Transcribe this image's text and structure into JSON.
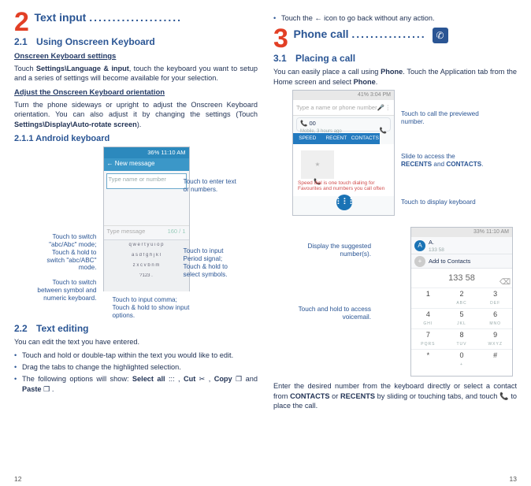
{
  "left": {
    "sec_num": "2",
    "sec_title": "Text input",
    "sec_dots": "....................",
    "s21_num": "2.1",
    "s21_title": "Using Onscreen Keyboard",
    "sub_a": "Onscreen Keyboard settings",
    "para_a": "Touch <b>Settings\\Language & input</b>, touch the keyboard you want to setup and a series of settings will become available for your selection.",
    "sub_b": "Adjust the Onscreen Keyboard orientation",
    "para_b": "Turn the phone sideways or upright to adjust the Onscreen Keyboard orientation. You can also adjust it by changing the settings (Touch <b>Settings\\Display\\Auto-rotate screen</b>).",
    "s211_num": "2.1.1",
    "s211_title": "Android keyboard",
    "shot1": {
      "status": "36%  11:10 AM",
      "title": "New message",
      "field": "Type name or number",
      "counter": "160 / 1",
      "msg": "Type message",
      "row1": "q w e r t y u i o p",
      "row2": "a s d f g h j k l",
      "row3": "z x c v b n m",
      "row4": "?123        ."
    },
    "callouts1": {
      "c1": "Touch to enter text or numbers.",
      "c2": "Touch to switch \"abc/Abc\" mode; Touch & hold to switch \"abc/ABC\" mode.",
      "c3": "Touch to switch between symbol and numeric keyboard.",
      "c4": "Touch to input Period signal;\nTouch & hold to select symbols.",
      "c5": "Touch to input comma;\nTouch & hold to show input options."
    },
    "s22_num": "2.2",
    "s22_title": "Text editing",
    "para_c": "You can edit the text you have entered.",
    "bullets": [
      "Touch and hold or double-tap within the text you would like to edit.",
      "Drag the tabs to change the highlighted selection.",
      "The following options will show: <b>Select all</b> :::  , <b>Cut</b> ✂ , <b>Copy</b> ❐ and <b>Paste</b> ❐ ."
    ],
    "pagenum": "12"
  },
  "right": {
    "top_bullet": "Touch the ← icon to go back without any action.",
    "sec_num": "3",
    "sec_title": "Phone call",
    "sec_dots": "................",
    "s31_num": "3.1",
    "s31_title": "Placing a call",
    "para_a": "You can easily place a call using <b>Phone</b>. Touch the Application tab from the Home screen and select <b>Phone</b>.",
    "shot2": {
      "status": "41%  3:04 PM",
      "search": "Type a name or phone number",
      "pill_top": "00",
      "pill_sub": "Mobile, 3 hours ago",
      "tab1": "SPEED DIAL",
      "tab2": "RECENT",
      "tab3": "CONTACTS",
      "bodytxt": "Speed dial is one touch dialing for Favourites and numbers you call often"
    },
    "callouts2": {
      "c1": "Touch to call the previewed number.",
      "c2": "Slide to access the <b>RECENTS</b> and <b>CONTACTS</b>.",
      "c3": "Touch to display keyboard"
    },
    "shot3": {
      "status": "33%  11:10 AM",
      "sel_top": "A.",
      "sel_sub": "133 58",
      "add": "Add to Contacts",
      "number": "133 58",
      "keys": [
        "1",
        "2",
        "3",
        "4",
        "5",
        "6",
        "7",
        "8",
        "9",
        "*",
        "0",
        "#"
      ],
      "sub": [
        "",
        "ABC",
        "DEF",
        "GHI",
        "JKL",
        "MNO",
        "PQRS",
        "TUV",
        "WXYZ",
        "",
        "+",
        ""
      ]
    },
    "callouts3": {
      "c1": "Display the suggested number(s).",
      "c2": "Touch and hold to access voicemail."
    },
    "para_b": "Enter the desired number from the keyboard directly or select a contact from <b>CONTACTS</b> or <b>RECENTS</b> by sliding or touching tabs, and touch 📞 to place the call.",
    "pagenum": "13"
  }
}
